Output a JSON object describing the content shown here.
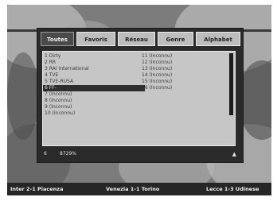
{
  "tabs": [
    "Toutes",
    "Favoris",
    "Réseau",
    "Genre",
    "Alphabet"
  ],
  "active_tab": 0,
  "channels_left": [
    "1 Dirty",
    "2 RR",
    "3 RAI International",
    "4 TVE",
    "5 TVE-RUSA",
    "6 FF-",
    "7 (Inconnu)",
    "8 (Inconnu)",
    "9 (Inconnu)",
    "10 (Inconnu)"
  ],
  "selected_index": 5,
  "channels_right": [
    "11 (Inconnu)",
    "12 (Inconnu)",
    "13 (Inconnu)",
    "14 (Inconnu)",
    "15 (Inconnu)",
    "16 (Inconnu)"
  ],
  "info_bar": {
    "number": "6",
    "code": "8729%"
  },
  "ticker": [
    "Inter 2-1 Piacenza",
    "Venezia 1-1 Torino",
    "Lecce 1-3 Udinese"
  ],
  "colors": {
    "panel": "#2a2a2a",
    "list_bg": "#c6c6c6",
    "selection": "#2e2e2e",
    "ticker_bg": "#262626"
  }
}
